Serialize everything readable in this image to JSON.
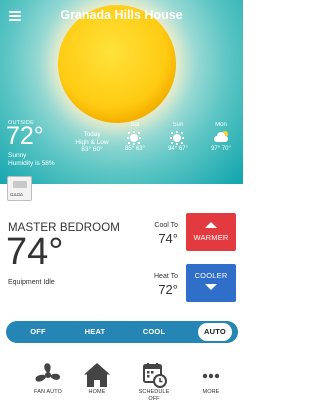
{
  "header": {
    "home_name": "Granada Hills House"
  },
  "weather": {
    "outside_label": "OUTSIDE",
    "outside_temp": "72°",
    "condition": "Sunny",
    "humidity": "Humidity is 58%",
    "today": {
      "label": "Today",
      "sub": "High & Low",
      "temps": "83° 60°"
    },
    "forecast": [
      {
        "day": "Sat",
        "icon": "sun-icon",
        "temps": "85° 63°"
      },
      {
        "day": "Sun",
        "icon": "sun-icon",
        "temps": "94° 67°"
      },
      {
        "day": "Mon",
        "icon": "partly-cloudy-icon",
        "temps": "97° 70°"
      }
    ]
  },
  "thermostat": {
    "icon_label": "ΩΔΩΔ",
    "room_name": "MASTER BEDROOM",
    "current_temp": "74°",
    "status": "Equipment Idle",
    "cool_to_label": "Cool To",
    "cool_to_value": "74°",
    "heat_to_label": "Heat To",
    "heat_to_value": "72°",
    "warmer_label": "WARMER",
    "cooler_label": "COOLER"
  },
  "modes": {
    "items": [
      "OFF",
      "HEAT",
      "COOL",
      "AUTO"
    ],
    "selected": "AUTO"
  },
  "nav": {
    "fan": "FAN AUTO",
    "home": "HOME",
    "schedule_line1": "SCHEDULE",
    "schedule_line2": "OFF",
    "more": "MORE"
  },
  "colors": {
    "warmer": "#e23a3f",
    "cooler": "#2f6fc9",
    "mode_bar": "#2585b4",
    "sky": "#14a6ae"
  }
}
